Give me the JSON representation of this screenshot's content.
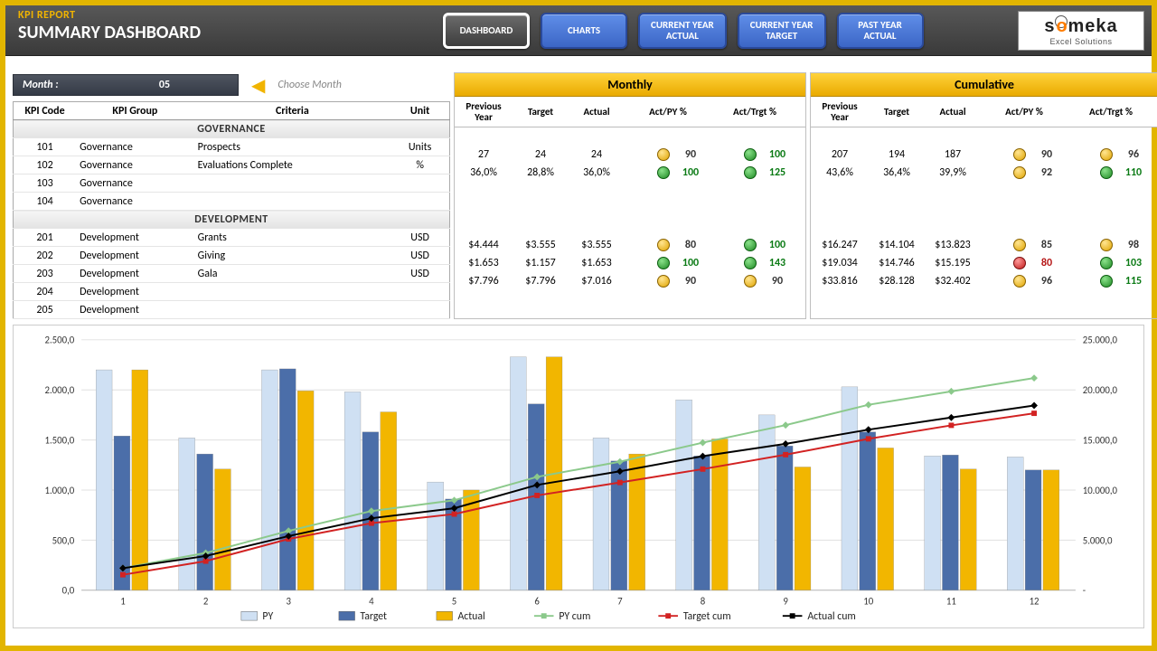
{
  "header": {
    "kicker": "KPI REPORT",
    "title": "SUMMARY DASHBOARD",
    "nav": [
      {
        "label": "DASHBOARD",
        "active": true
      },
      {
        "label": "CHARTS",
        "active": false
      },
      {
        "label": "CURRENT YEAR ACTUAL",
        "active": false,
        "twoLine": true
      },
      {
        "label": "CURRENT YEAR TARGET",
        "active": false,
        "twoLine": true
      },
      {
        "label": "PAST YEAR ACTUAL",
        "active": false,
        "twoLine": true
      }
    ],
    "logo": {
      "brand": "someka",
      "sub": "Excel Solutions"
    }
  },
  "month": {
    "label": "Month :",
    "value": "05",
    "hint": "Choose Month"
  },
  "leftCols": {
    "code": "KPI Code",
    "group": "KPI Group",
    "criteria": "Criteria",
    "unit": "Unit"
  },
  "sections": [
    {
      "name": "GOVERNANCE",
      "rows": [
        {
          "code": "101",
          "group": "Governance",
          "criteria": "Prospects",
          "unit": "Units"
        },
        {
          "code": "102",
          "group": "Governance",
          "criteria": "Evaluations Complete",
          "unit": "%"
        },
        {
          "code": "103",
          "group": "Governance",
          "criteria": "",
          "unit": ""
        },
        {
          "code": "104",
          "group": "Governance",
          "criteria": "",
          "unit": ""
        }
      ]
    },
    {
      "name": "DEVELOPMENT",
      "rows": [
        {
          "code": "201",
          "group": "Development",
          "criteria": "Grants",
          "unit": "USD"
        },
        {
          "code": "202",
          "group": "Development",
          "criteria": "Giving",
          "unit": "USD"
        },
        {
          "code": "203",
          "group": "Development",
          "criteria": "Gala",
          "unit": "USD"
        },
        {
          "code": "204",
          "group": "Development",
          "criteria": "",
          "unit": ""
        },
        {
          "code": "205",
          "group": "Development",
          "criteria": "",
          "unit": ""
        }
      ]
    }
  ],
  "panelCols": {
    "py": "Previous Year",
    "target": "Target",
    "actual": "Actual",
    "actPy": "Act/PY %",
    "actTrgt": "Act/Trgt %"
  },
  "panels": [
    {
      "title": "Monthly",
      "groups": [
        [
          {
            "py": "27",
            "target": "24",
            "actual": "24",
            "apS": "y",
            "ap": "90",
            "atS": "g",
            "at": "100"
          },
          {
            "py": "36,0%",
            "target": "28,8%",
            "actual": "36,0%",
            "apS": "g",
            "ap": "100",
            "atS": "g",
            "at": "125"
          }
        ],
        [
          {
            "py": "$4.444",
            "target": "$3.555",
            "actual": "$3.555",
            "apS": "y",
            "ap": "80",
            "atS": "g",
            "at": "100"
          },
          {
            "py": "$1.653",
            "target": "$1.157",
            "actual": "$1.653",
            "apS": "g",
            "ap": "100",
            "atS": "g",
            "at": "143"
          },
          {
            "py": "$7.796",
            "target": "$7.796",
            "actual": "$7.016",
            "apS": "y",
            "ap": "90",
            "atS": "y",
            "at": "90"
          }
        ]
      ]
    },
    {
      "title": "Cumulative",
      "groups": [
        [
          {
            "py": "207",
            "target": "194",
            "actual": "187",
            "apS": "y",
            "ap": "90",
            "atS": "y",
            "at": "96"
          },
          {
            "py": "43,6%",
            "target": "36,4%",
            "actual": "39,9%",
            "apS": "y",
            "ap": "92",
            "atS": "g",
            "at": "110"
          }
        ],
        [
          {
            "py": "$16.247",
            "target": "$14.104",
            "actual": "$13.823",
            "apS": "y",
            "ap": "85",
            "atS": "y",
            "at": "98"
          },
          {
            "py": "$19.034",
            "target": "$14.746",
            "actual": "$15.195",
            "apS": "r",
            "ap": "80",
            "atS": "g",
            "at": "103"
          },
          {
            "py": "$33.816",
            "target": "$28.128",
            "actual": "$32.402",
            "apS": "y",
            "ap": "96",
            "atS": "g",
            "at": "115"
          }
        ]
      ]
    }
  ],
  "chart_data": {
    "type": "bar",
    "categories": [
      "1",
      "2",
      "3",
      "4",
      "5",
      "6",
      "7",
      "8",
      "9",
      "10",
      "11",
      "12"
    ],
    "yLeft": {
      "label": "",
      "min": 0,
      "max": 2500,
      "ticks": [
        "0,0",
        "500,0",
        "1.000,0",
        "1.500,0",
        "2.000,0",
        "2.500,0"
      ]
    },
    "yRight": {
      "label": "",
      "min": 0,
      "max": 25000,
      "ticks": [
        "-",
        "5.000,0",
        "10.000,0",
        "15.000,0",
        "20.000,0",
        "25.000,0"
      ]
    },
    "series": [
      {
        "name": "PY",
        "kind": "bar",
        "color": "#cfe0f3",
        "values": [
          2200,
          1520,
          2200,
          1980,
          1080,
          2330,
          1520,
          1900,
          1750,
          2030,
          1340,
          1330
        ]
      },
      {
        "name": "Target",
        "kind": "bar",
        "color": "#4b6ea9",
        "values": [
          1540,
          1360,
          2210,
          1580,
          910,
          1860,
          1290,
          1340,
          1440,
          1580,
          1350,
          1200
        ]
      },
      {
        "name": "Actual",
        "kind": "bar",
        "color": "#f2b600",
        "values": [
          2200,
          1210,
          1990,
          1780,
          1000,
          2330,
          1360,
          1510,
          1230,
          1420,
          1210,
          1200
        ]
      },
      {
        "name": "PY cum",
        "kind": "line",
        "color": "#8bc98b",
        "marker": "diamond",
        "values": [
          2200,
          3720,
          5920,
          7900,
          8980,
          11310,
          12830,
          14730,
          16480,
          18510,
          19850,
          21180
        ]
      },
      {
        "name": "Target cum",
        "kind": "line",
        "color": "#d22222",
        "marker": "square",
        "values": [
          1540,
          2900,
          5110,
          6690,
          7600,
          9460,
          10750,
          12090,
          13530,
          15110,
          16460,
          17660
        ]
      },
      {
        "name": "Actual cum",
        "kind": "line",
        "color": "#000000",
        "marker": "diamond",
        "values": [
          2200,
          3410,
          5400,
          7180,
          8180,
          10510,
          11870,
          13380,
          14610,
          16030,
          17240,
          18440
        ]
      }
    ],
    "legend": [
      "PY",
      "Target",
      "Actual",
      "PY cum",
      "Target cum",
      "Actual cum"
    ]
  }
}
